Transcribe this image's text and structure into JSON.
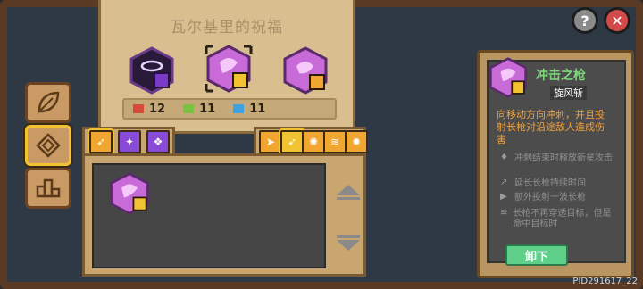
{
  "title": "瓦尔基里的祝福",
  "counts": [
    {
      "value": "12",
      "color": "#d84a3a"
    },
    {
      "value": "11",
      "color": "#7ac23f"
    },
    {
      "value": "11",
      "color": "#3fa2e0"
    }
  ],
  "detail": {
    "name": "冲击之枪",
    "subtitle": "旋风斩",
    "description": "向移动方向冲刺，并且投射长枪对沿途敌人造成伤害",
    "features": [
      "冲刺结束时释放新星攻击",
      "延长长枪持续时间",
      "额外投射一波长枪",
      "长枪不再穿透目标，但是命中目标时"
    ]
  },
  "unequip_label": "卸下",
  "pid_label": "PID291617_22",
  "help_label": "?",
  "close_label": "✕"
}
